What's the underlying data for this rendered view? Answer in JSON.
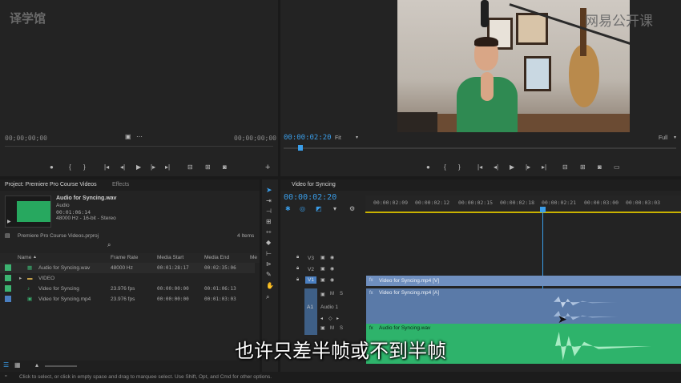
{
  "watermark_left": "译学馆",
  "watermark_right": "网易公开课",
  "source_monitor": {
    "timecode_left": "00;00;00;00",
    "timecode_right": "00;00;00;00"
  },
  "program_monitor": {
    "timecode": "00:00:02:20",
    "fit_label": "Fit",
    "quality_label": "Full"
  },
  "project_panel": {
    "tabs": [
      "Project: Premiere Pro Course Videos",
      "Effects"
    ],
    "preview": {
      "name": "Audio for Syncing.wav",
      "type": "Audio",
      "duration": "00:01:06:14",
      "format": "48000 Hz - 16-bit - Stereo"
    },
    "project_file": "Premiere Pro Course Videos.prproj",
    "items_count": "4 Items",
    "columns": [
      "Name",
      "Frame Rate",
      "Media Start",
      "Media End",
      "Me"
    ],
    "rows": [
      {
        "color": "#3cb371",
        "name": "Audio for Syncing.wav",
        "frame_rate": "48000 Hz",
        "media_start": "00:01:28:17",
        "media_end": "00:02:35:06"
      },
      {
        "color": "#3cb371",
        "name": "VIDEO",
        "frame_rate": "",
        "media_start": "",
        "media_end": ""
      },
      {
        "color": "#3cb371",
        "name": "Video for Syncing",
        "frame_rate": "23.976 fps",
        "media_start": "00:00:00:00",
        "media_end": "00:01:06:13"
      },
      {
        "color": "#4a7fc1",
        "name": "Video for Syncing.mp4",
        "frame_rate": "23.976 fps",
        "media_start": "00:00:00:00",
        "media_end": "00:01:03:03"
      }
    ]
  },
  "timeline": {
    "sequence_name": "Video for Syncing",
    "timecode": "00:00:02:20",
    "ruler": [
      "00:00:02:09",
      "00:00:02:12",
      "00:00:02:15",
      "00:00:02:18",
      "00:00:02:21",
      "00:00:03:00",
      "00:00:03:03"
    ],
    "tracks": {
      "v3": "V3",
      "v2": "V2",
      "v1": "V1",
      "a1": "A1",
      "a1_name": "Audio 1",
      "m": "M",
      "s": "S"
    },
    "clip_video": "Video for Syncing.mp4 [V]",
    "clip_audio_a1": "Video for Syncing.mp4 [A]",
    "clip_audio_a2": "Audio for Syncing.wav",
    "clip_fx": "fx",
    "clip_value": "0.0"
  },
  "subtitle": "也许只差半帧或不到半帧",
  "status_bar": "Click to select, or click in empty space and drag to marquee select. Use Shift, Opt, and Cmd for other options.",
  "colors": {
    "accent": "#3a9de8",
    "video_clip": "#6f8fbf",
    "audio_clip": "#2eb36b"
  }
}
